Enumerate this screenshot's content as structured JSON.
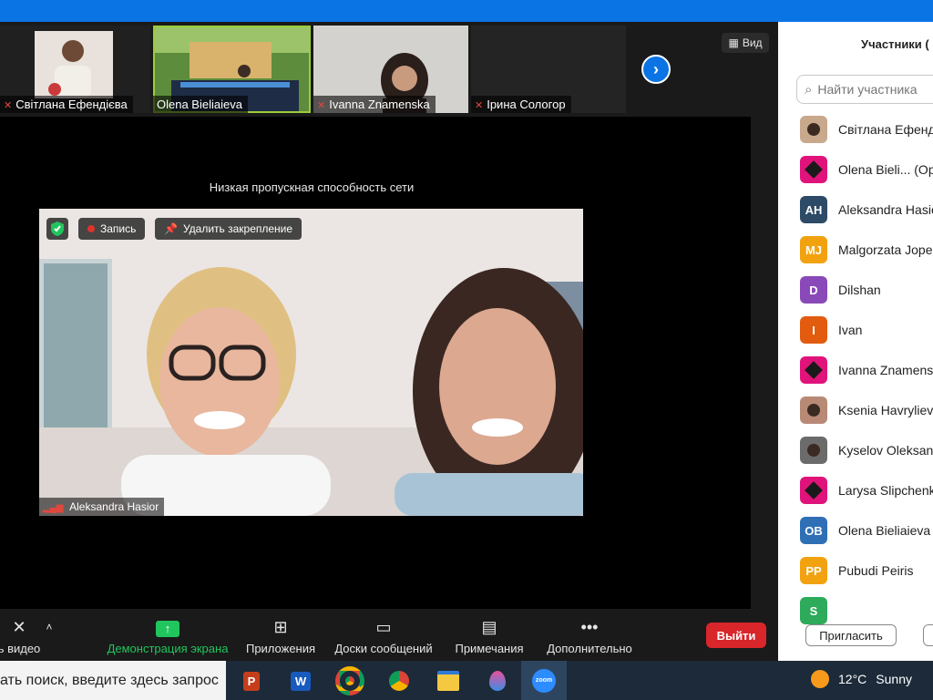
{
  "thumbnails": [
    {
      "name": "Світлана Ефендієва",
      "muted": true,
      "active": false
    },
    {
      "name": "Olena Bieliaieva",
      "muted": false,
      "active": true
    },
    {
      "name": "Ivanna Znamenska",
      "muted": true,
      "active": false
    },
    {
      "name": "Ірина Сологор",
      "muted": true,
      "active": false
    }
  ],
  "view_label": "Вид",
  "network_warning": "Низкая пропускная способность сети",
  "video_controls": {
    "record": "Запись",
    "unpin": "Удалить закрепление"
  },
  "main_video_name": "Aleksandra Hasior",
  "toolbar": {
    "video": "ь видео",
    "share": "Демонстрация экрана",
    "apps": "Приложения",
    "whiteboards": "Доски сообщений",
    "notes": "Примечания",
    "more": "Дополнительно",
    "leave": "Выйти"
  },
  "participants_panel": {
    "title": "Участники (",
    "search_placeholder": "Найти участника",
    "invite": "Пригласить",
    "participants": [
      {
        "name": "Світлана Ефенді",
        "initials": "",
        "color": "#c9a98c",
        "kind": "photo"
      },
      {
        "name": "Olena Bieli...  (Ор",
        "initials": "",
        "color": "#e0137b",
        "kind": "logo"
      },
      {
        "name": "Aleksandra Hasio",
        "initials": "AH",
        "color": "#2d4a66",
        "kind": "initials"
      },
      {
        "name": "Malgorzata Jope",
        "initials": "MJ",
        "color": "#f2a20f",
        "kind": "initials"
      },
      {
        "name": "Dilshan",
        "initials": "D",
        "color": "#8a49b8",
        "kind": "initials"
      },
      {
        "name": "Ivan",
        "initials": "I",
        "color": "#e25b0f",
        "kind": "initials"
      },
      {
        "name": "Ivanna Znamensk",
        "initials": "",
        "color": "#e0137b",
        "kind": "logo"
      },
      {
        "name": "Ksenia Havrylieva",
        "initials": "",
        "color": "#b88a76",
        "kind": "photo"
      },
      {
        "name": "Kyselov Oleksand",
        "initials": "",
        "color": "#6b6b6b",
        "kind": "photo"
      },
      {
        "name": "Larysa Slipchenko",
        "initials": "",
        "color": "#e0137b",
        "kind": "logo"
      },
      {
        "name": "Olena Bieliaieva",
        "initials": "OB",
        "color": "#2f6fb6",
        "kind": "initials"
      },
      {
        "name": "Pubudi Peiris",
        "initials": "PP",
        "color": "#f2a20f",
        "kind": "initials"
      },
      {
        "name": "",
        "initials": "S",
        "color": "#2daa5a",
        "kind": "initials"
      }
    ]
  },
  "taskbar": {
    "search_text": "ать поиск, введите здесь запрос",
    "temperature": "12°C",
    "weather": "Sunny",
    "apps": [
      "powerpoint-icon",
      "word-icon",
      "chrome-icon",
      "chrome-profile-icon",
      "file-explorer-icon",
      "paint-icon",
      "zoom-icon"
    ]
  }
}
